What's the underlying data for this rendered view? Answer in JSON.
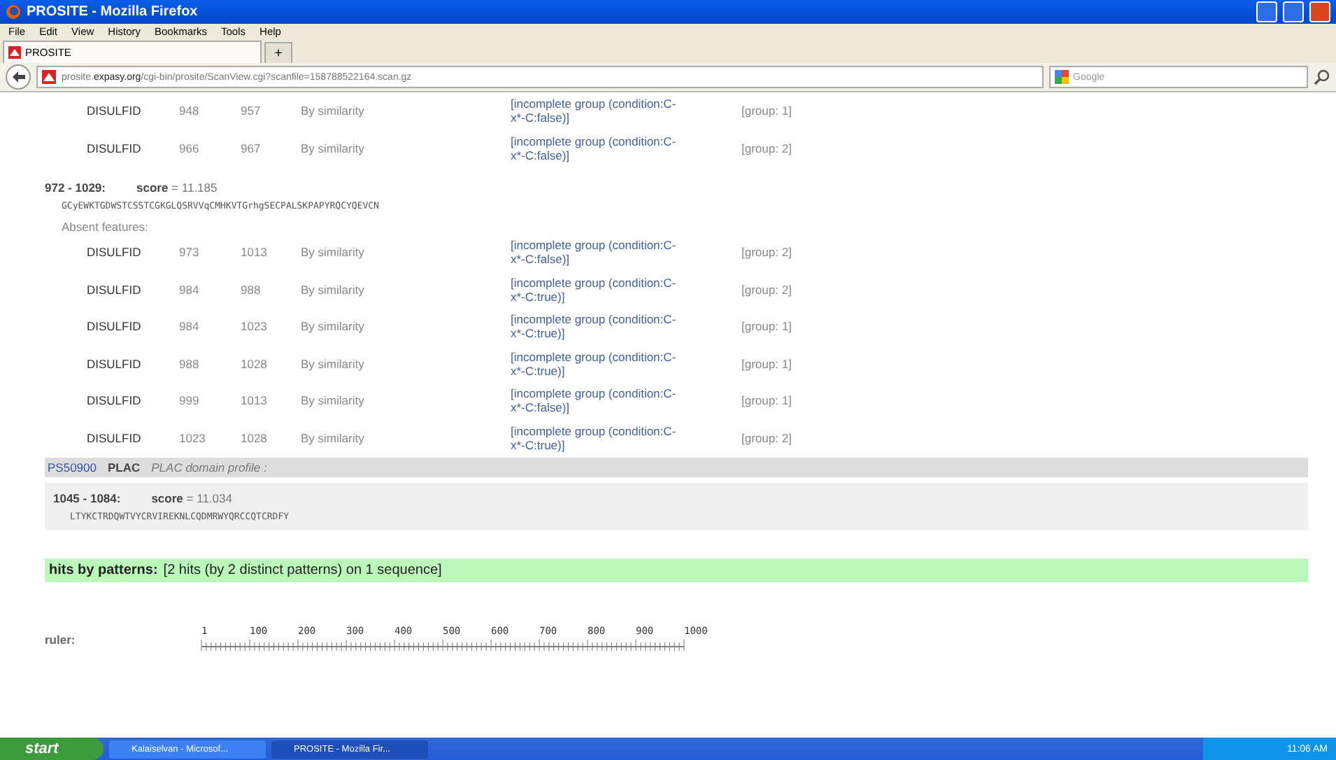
{
  "window": {
    "title": "PROSITE - Mozilla Firefox"
  },
  "menu": [
    "File",
    "Edit",
    "View",
    "History",
    "Bookmarks",
    "Tools",
    "Help"
  ],
  "tabs": [
    {
      "label": "PROSITE",
      "selected": true
    }
  ],
  "new_tab": "+",
  "address": {
    "host_prefix": "prosite.",
    "host": "expasy.org",
    "path": "/cgi-bin/prosite/ScanView.cgi?scanfile=158788522164.scan.gz"
  },
  "search": {
    "placeholder": "Google"
  },
  "top_rows": [
    {
      "type": "DISULFID",
      "start": "948",
      "end": "957",
      "evidence": "By similarity",
      "condition": "[incomplete group (condition:C-x*-C:false)]",
      "group": "[group: 1]"
    },
    {
      "type": "DISULFID",
      "start": "966",
      "end": "967",
      "evidence": "By similarity",
      "condition": "[incomplete group (condition:C-x*-C:false)]",
      "group": "[group: 2]"
    }
  ],
  "hit1": {
    "range": "972 - 1029:",
    "score_label": "score",
    "score": "= 11.185",
    "sequence": "GCyEWKTGDWSTCSSTCGKGLQSRVVqCMHKVTGrhgSECPALSKPAPYRQCYQEVCN",
    "absent_label": "Absent features:",
    "rows": [
      {
        "type": "DISULFID",
        "start": "973",
        "end": "1013",
        "evidence": "By similarity",
        "condition": "[incomplete group (condition:C-x*-C:false)]",
        "group": "[group: 2]"
      },
      {
        "type": "DISULFID",
        "start": "984",
        "end": "988",
        "evidence": "By similarity",
        "condition": "[incomplete group (condition:C-x*-C:true)]",
        "group": "[group: 2]"
      },
      {
        "type": "DISULFID",
        "start": "984",
        "end": "1023",
        "evidence": "By similarity",
        "condition": "[incomplete group (condition:C-x*-C:true)]",
        "group": "[group: 1]"
      },
      {
        "type": "DISULFID",
        "start": "988",
        "end": "1028",
        "evidence": "By similarity",
        "condition": "[incomplete group (condition:C-x*-C:true)]",
        "group": "[group: 1]"
      },
      {
        "type": "DISULFID",
        "start": "999",
        "end": "1013",
        "evidence": "By similarity",
        "condition": "[incomplete group (condition:C-x*-C:false)]",
        "group": "[group: 1]"
      },
      {
        "type": "DISULFID",
        "start": "1023",
        "end": "1028",
        "evidence": "By similarity",
        "condition": "[incomplete group (condition:C-x*-C:true)]",
        "group": "[group: 2]"
      }
    ]
  },
  "profile": {
    "accession": "PS50900",
    "name": "PLAC",
    "description": "PLAC domain profile :"
  },
  "hit2": {
    "range": "1045 - 1084:",
    "score_label": "score",
    "score": "= 11.034",
    "sequence": "LTYKCTRDQWTVYCRVIREKNLCQDMRWYQRCCQTCRDFY"
  },
  "summary": {
    "label": "hits by patterns:",
    "text": "[2 hits (by 2 distinct patterns) on 1 sequence]"
  },
  "ruler": {
    "label": "ruler:",
    "ticks": [
      "1",
      "100",
      "200",
      "300",
      "400",
      "500",
      "600",
      "700",
      "800",
      "900",
      "1000"
    ]
  },
  "taskbar": {
    "start": "start",
    "tasks": [
      {
        "label": "Kalaiselvan - Microsof...",
        "selected": false
      },
      {
        "label": "PROSITE - Mozilla Fir...",
        "selected": true
      }
    ],
    "clock": "11:06 AM"
  }
}
